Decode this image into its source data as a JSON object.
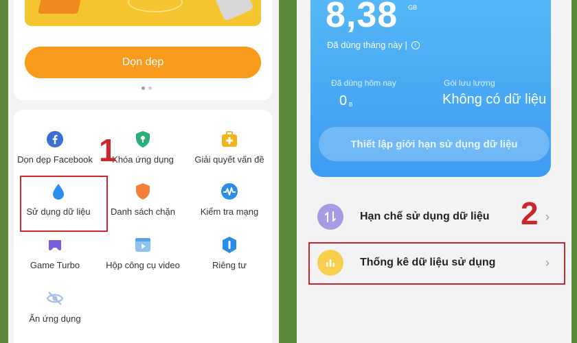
{
  "left": {
    "clean_button": "Dọn dẹp",
    "tools": [
      {
        "label": "Dọn dẹp Facebook",
        "icon": "facebook-icon"
      },
      {
        "label": "Khóa ứng dụng",
        "icon": "app-lock-shield-icon"
      },
      {
        "label": "Giải quyết vấn đề",
        "icon": "first-aid-kit-icon"
      },
      {
        "label": "Sử dụng dữ liệu",
        "icon": "water-drop-icon"
      },
      {
        "label": "Danh sách chặn",
        "icon": "block-shield-icon"
      },
      {
        "label": "Kiểm tra mạng",
        "icon": "network-pulse-icon"
      },
      {
        "label": "Game Turbo",
        "icon": "gamepad-icon"
      },
      {
        "label": "Hộp công cụ video",
        "icon": "video-toolbox-icon"
      },
      {
        "label": "Riêng tư",
        "icon": "privacy-shield-icon"
      },
      {
        "label": "Ẩn ứng dụng",
        "icon": "hidden-eye-icon"
      }
    ],
    "step_number": "1"
  },
  "right": {
    "data_used": "8,38",
    "data_unit": "GB",
    "used_this_month": "Đã dùng tháng này |",
    "used_today_label": "Đã dùng hôm nay",
    "used_today_value": "0",
    "used_today_unit": "B",
    "plan_label": "Gói lưu lượng",
    "plan_value": "Không có dữ liệu",
    "set_limit_button": "Thiết lập giới hạn sử dụng dữ liệu",
    "rows": [
      {
        "label": "Hạn chế sử dụng dữ liệu",
        "icon": "up-down-arrows-icon",
        "color": "#a99ae6"
      },
      {
        "label": "Thống kê dữ liệu sử dụng",
        "icon": "bar-chart-icon",
        "color": "#f7cf4d"
      }
    ],
    "step_number": "2"
  },
  "colors": {
    "accent_orange": "#f89a1c",
    "card_blue": "#3d9cf2",
    "annotation_red": "#c8272c",
    "background_green": "#5b8a3a"
  }
}
